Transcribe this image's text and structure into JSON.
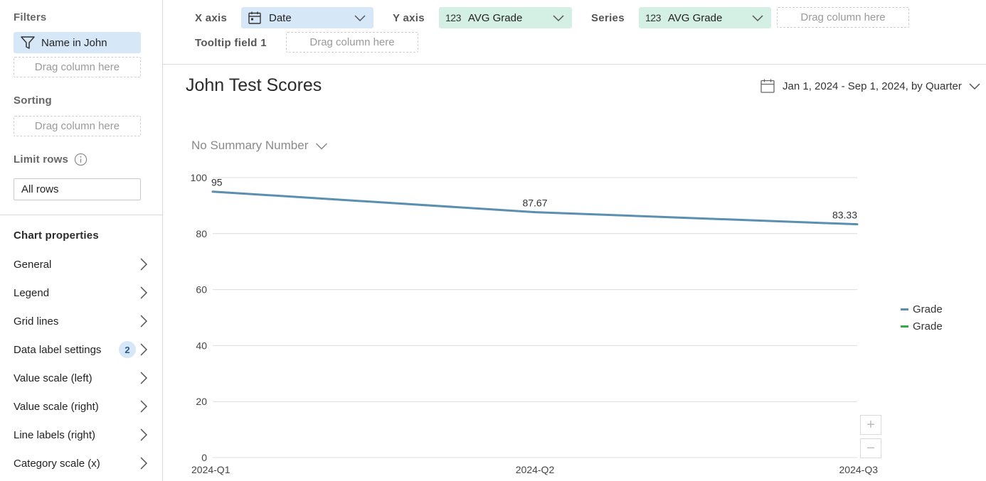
{
  "sidebar": {
    "filters_title": "Filters",
    "filter_chip": "Name in John",
    "filter_drop": "Drag column here",
    "sorting_title": "Sorting",
    "sorting_drop": "Drag column here",
    "limit_title": "Limit rows",
    "limit_value": "All rows",
    "props_title": "Chart properties",
    "props": [
      {
        "label": "General"
      },
      {
        "label": "Legend"
      },
      {
        "label": "Grid lines"
      },
      {
        "label": "Data label settings",
        "badge": "2"
      },
      {
        "label": "Value scale (left)"
      },
      {
        "label": "Value scale (right)"
      },
      {
        "label": "Line labels (right)"
      },
      {
        "label": "Category scale (x)"
      }
    ]
  },
  "topbar": {
    "x_axis_label": "X axis",
    "x_axis_value": "Date",
    "y_axis_label": "Y axis",
    "y_axis_icon": "123",
    "y_axis_value": "AVG Grade",
    "series_label": "Series",
    "series_icon": "123",
    "series_value": "AVG Grade",
    "series_drop": "Drag column here",
    "tooltip_label": "Tooltip field 1",
    "tooltip_drop": "Drag column here"
  },
  "chart_header": {
    "title": "John Test Scores",
    "date_range": "Jan 1, 2024 - Sep 1, 2024, by Quarter",
    "summary": "No Summary Number"
  },
  "colors": {
    "series_line": "#5b8fb0",
    "legend_green": "#3aa64a",
    "accent_blue_bg": "#d6e8f8",
    "accent_green_bg": "#d4efe3"
  },
  "chart_data": {
    "type": "line",
    "categories": [
      "2024-Q1",
      "2024-Q2",
      "2024-Q3"
    ],
    "series": [
      {
        "name": "Grade",
        "values": [
          95,
          87.67,
          83.33
        ],
        "labels": [
          "95",
          "87.67",
          "83.33"
        ]
      }
    ],
    "legend": [
      "Grade",
      "Grade"
    ],
    "ylim": [
      0,
      100
    ],
    "yticks": [
      0,
      20,
      40,
      60,
      80,
      100
    ],
    "grid": true,
    "legend_position": "right"
  },
  "zoom": {
    "plus": "+",
    "minus": "−"
  }
}
